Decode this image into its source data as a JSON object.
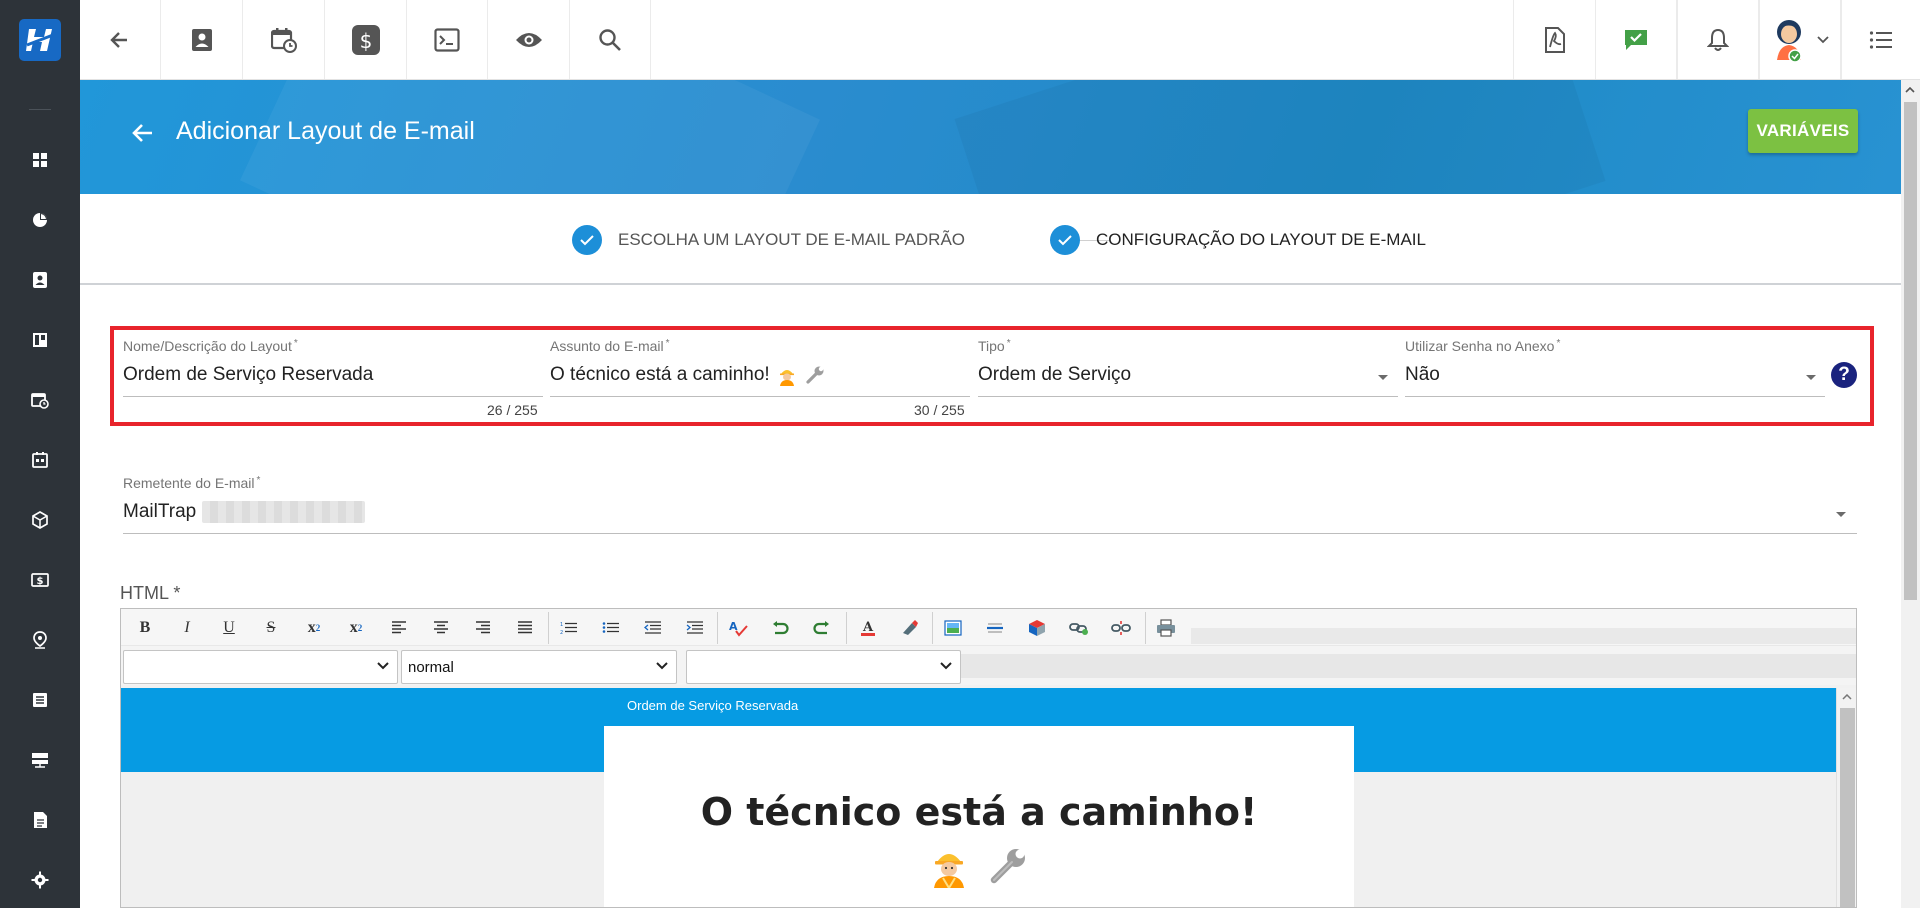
{
  "header": {
    "title": "Adicionar Layout de E-mail",
    "variables_button": "VARIÁVEIS"
  },
  "stepper": {
    "step1": "ESCOLHA UM LAYOUT DE E-MAIL PADRÃO",
    "step2": "CONFIGURAÇÃO DO LAYOUT DE E-MAIL"
  },
  "form": {
    "name": {
      "label": "Nome/Descrição do Layout",
      "value": "Ordem de Serviço Reservada",
      "counter": "26 / 255"
    },
    "subject": {
      "label": "Assunto do E-mail",
      "value": "O técnico está a caminho!",
      "counter": "30 / 255"
    },
    "type": {
      "label": "Tipo",
      "value": "Ordem de Serviço"
    },
    "password": {
      "label": "Utilizar Senha no Anexo",
      "value": "Não"
    },
    "required_mark": "*",
    "help": "?",
    "sender": {
      "label": "Remetente do E-mail",
      "value": "MailTrap"
    },
    "html_label": "HTML *"
  },
  "editor": {
    "toolbar": {
      "bold": "B",
      "italic": "I",
      "underline": "U",
      "strike": "S",
      "sub": "x",
      "sub_mark": "2",
      "sup": "x",
      "sup_mark": "2"
    },
    "font_select": "",
    "size_select": "normal",
    "color_select": "",
    "preview": {
      "top_label": "Ordem de Serviço Reservada",
      "heading": "O técnico está a caminho!"
    }
  },
  "colors": {
    "accent": "#1d8fd8",
    "header_blue": "#2197d9",
    "variables_green": "#7cc142",
    "highlight_red": "#e8242c",
    "sidebar": "#2d3339"
  },
  "icons": {
    "sidebar": [
      "logo-icon",
      "dashboard-icon",
      "chart-pie-icon",
      "contact-card-icon",
      "board-icon",
      "calendar-clock-icon",
      "calendar-grid-icon",
      "package-icon",
      "money-icon",
      "location-icon",
      "list-icon",
      "server-icon",
      "document-icon",
      "settings-icon"
    ],
    "topbar": [
      "back-arrow-icon",
      "contact-icon",
      "calendar-clock-icon",
      "dollar-icon",
      "terminal-icon",
      "eye-icon",
      "search-icon",
      "pdf-icon",
      "chat-check-icon",
      "bell-icon",
      "avatar",
      "chevron-down-icon",
      "menu-list-icon"
    ]
  }
}
